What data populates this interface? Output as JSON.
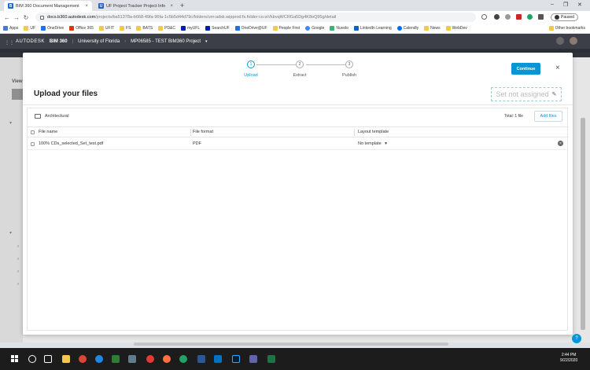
{
  "browser": {
    "tabs": [
      {
        "title": "BIM 360 Document Management",
        "active": true
      },
      {
        "title": "UF Project Tracker Project Info",
        "active": false
      }
    ],
    "new_tab": "+",
    "url_host": "docs.b360.autodesk.com",
    "url_path": "/projects/ba51378a-b668-49fa-96fa-1c5b5d44d79c/folders/urn:adsk.wipprod:fs.folder:co.wVkbvqWCRGa5Dg4K8oQ95g/detail",
    "profile_status": "Paused",
    "bookmarks": [
      "Apps",
      "UF",
      "OneDrive",
      "Office 365",
      "UFIT",
      "FS",
      "BATS",
      "PD&C",
      "myUFL",
      "SearchUF",
      "OneDrive@UF",
      "People First",
      "Google",
      "Nuvolo",
      "LinkedIn Learning",
      "Calendly",
      "News",
      "WebDev"
    ],
    "other_bookmarks": "Other bookmarks"
  },
  "app_header": {
    "brand": "AUTODESK",
    "product": "BIM 360",
    "org": "University of Florida",
    "project": "MP06585 - TEST BIM360 Project",
    "sidebar_view": "View"
  },
  "modal": {
    "steps": [
      {
        "num": "1",
        "label": "Upload"
      },
      {
        "num": "2",
        "label": "Extract"
      },
      {
        "num": "3",
        "label": "Publish"
      }
    ],
    "active_step": 1,
    "continue_label": "Continue",
    "close_glyph": "×",
    "title": "Upload your files",
    "set_status": "Set not assigned",
    "folder_name": "Architectural",
    "total_label": "Total: 1 file",
    "add_files_label": "Add files",
    "columns": [
      "File name",
      "File format",
      "Layout template"
    ],
    "rows": [
      {
        "file_name": "100% CDs_selected_Set_test.pdf",
        "file_format": "PDF",
        "layout_template": "No template"
      }
    ]
  },
  "taskbar": {
    "time": "2:44 PM",
    "date": "9/22/2020"
  },
  "colors": {
    "accent": "#0696d7",
    "header_bg": "#3c3f47"
  }
}
